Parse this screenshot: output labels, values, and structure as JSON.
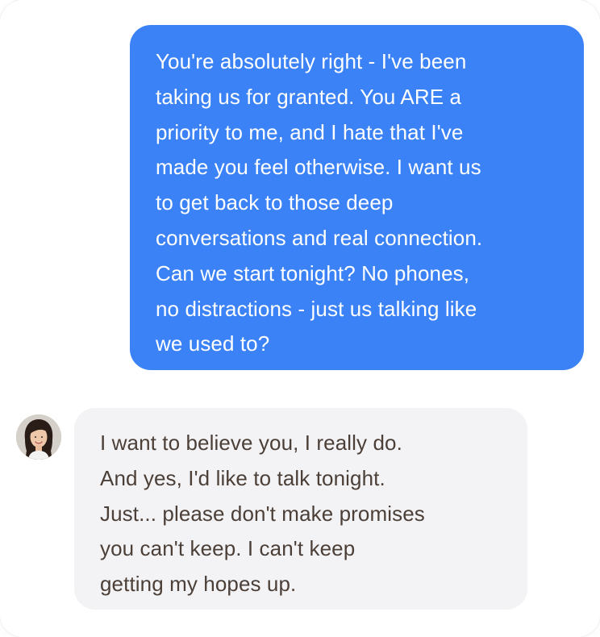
{
  "conversation": {
    "messages": [
      {
        "sender": "me",
        "lines": [
          "You're absolutely right - I've been",
          "taking us for granted. You ARE a",
          "priority to me, and I hate that I've",
          "made you feel otherwise. I want us",
          "to get back to those deep",
          "conversations and real connection.",
          "Can we start tonight? No phones,",
          "no distractions - just us talking like",
          "we used to?"
        ]
      },
      {
        "sender": "partner",
        "avatar_icon": "profile-photo-avatar",
        "lines": [
          "I want to believe you, I really do.",
          "And yes, I'd like to talk tonight.",
          "Just... please don't make promises",
          "you can't keep. I can't keep",
          "getting my hopes up."
        ]
      }
    ]
  },
  "colors": {
    "outgoing_bubble": "#3b82f6",
    "outgoing_text": "#ffffff",
    "incoming_bubble": "#f3f3f5",
    "incoming_text": "#4b3f38"
  }
}
